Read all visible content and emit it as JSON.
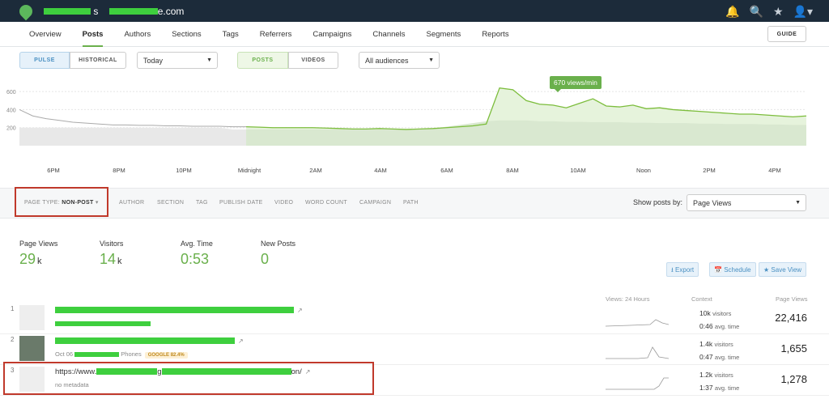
{
  "site": {
    "title_visible": "s",
    "domain_suffix": "e.com"
  },
  "nav": {
    "items": [
      "Overview",
      "Posts",
      "Authors",
      "Sections",
      "Tags",
      "Referrers",
      "Campaigns",
      "Channels",
      "Segments",
      "Reports"
    ],
    "active": "Posts",
    "guide": "GUIDE"
  },
  "controls": {
    "pulse": "PULSE",
    "historical": "HISTORICAL",
    "period": "Today",
    "posts": "POSTS",
    "videos": "VIDEOS",
    "audience": "All audiences"
  },
  "chart_data": {
    "type": "area",
    "y_ticks": [
      "600",
      "400",
      "200"
    ],
    "x_ticks": [
      "6PM",
      "8PM",
      "10PM",
      "Midnight",
      "2AM",
      "4AM",
      "6AM",
      "8AM",
      "10AM",
      "Noon",
      "2PM",
      "4PM"
    ],
    "tooltip": "670 views/min",
    "series": [
      {
        "values": [
          400,
          330,
          300,
          280,
          260,
          250,
          240,
          230,
          230,
          225,
          225,
          220,
          220,
          215,
          215,
          215,
          210,
          210,
          205,
          200,
          200,
          200,
          200,
          195,
          190,
          185,
          185,
          190,
          185,
          180,
          185,
          190,
          200,
          210,
          220,
          240,
          640,
          620,
          500,
          460,
          450,
          420,
          470,
          520,
          440,
          430,
          450,
          410,
          420,
          400,
          390,
          380,
          370,
          360,
          350,
          350,
          340,
          330,
          320,
          330
        ]
      },
      {
        "values": [
          200,
          200,
          200,
          200,
          200,
          200,
          200,
          200,
          200,
          200,
          200,
          200,
          200,
          200,
          200,
          200,
          180,
          180,
          180,
          180,
          180,
          180,
          180,
          180,
          180,
          180,
          180,
          180,
          180,
          180,
          180,
          190,
          210,
          230,
          250,
          270,
          280,
          280,
          280,
          270,
          270,
          265,
          265,
          260,
          260,
          260,
          255,
          255,
          250,
          250,
          250,
          245,
          245,
          240,
          240,
          240,
          235,
          235,
          230,
          230
        ]
      }
    ],
    "ylim": [
      0,
      700
    ]
  },
  "filters": {
    "page_type_label": "PAGE TYPE:",
    "page_type_value": "NON-POST",
    "others": [
      "AUTHOR",
      "SECTION",
      "TAG",
      "PUBLISH DATE",
      "VIDEO",
      "WORD COUNT",
      "CAMPAIGN",
      "PATH"
    ],
    "show_by_label": "Show posts by:",
    "show_by_value": "Page Views"
  },
  "stats": [
    {
      "label": "Page Views",
      "value": "29",
      "unit": "k"
    },
    {
      "label": "Visitors",
      "value": "14",
      "unit": "k"
    },
    {
      "label": "Avg. Time",
      "value": "0:53",
      "unit": ""
    },
    {
      "label": "New Posts",
      "value": "0",
      "unit": ""
    }
  ],
  "actions": {
    "export": "Export",
    "schedule": "Schedule",
    "save_view": "Save View"
  },
  "table": {
    "headers": {
      "views24": "Views: 24 Hours",
      "context": "Context",
      "pageviews": "Page Views"
    },
    "rows": [
      {
        "rank": "1",
        "title": "",
        "meta": "",
        "visitors": "10k",
        "time": "0:46",
        "pv": "22,416"
      },
      {
        "rank": "2",
        "title": "",
        "meta_date": "Oct 06",
        "meta_section": "Phones",
        "meta_badge": "GOOGLE 82.4%",
        "visitors": "1.4k",
        "time": "0:47",
        "pv": "1,655"
      },
      {
        "rank": "3",
        "title": "https://www.",
        "title_mid": "g",
        "title_end": "on/",
        "meta": "no metadata",
        "visitors": "1.2k",
        "time": "1:37",
        "pv": "1,278"
      }
    ],
    "visitors_unit": "visitors",
    "time_unit": "avg. time"
  }
}
